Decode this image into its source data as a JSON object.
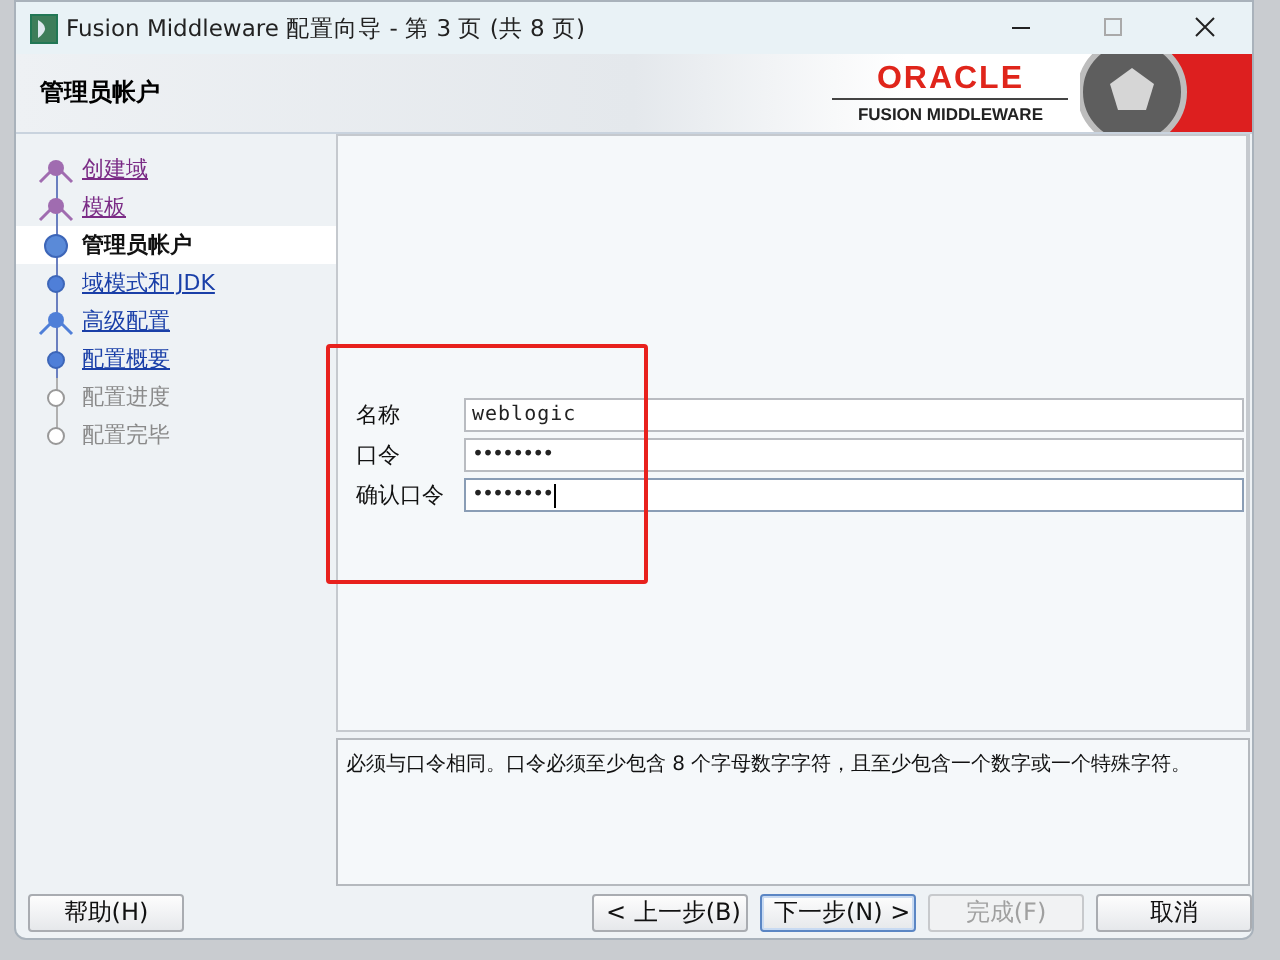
{
  "window": {
    "title": "Fusion Middleware 配置向导 - 第 3 页 (共 8 页)"
  },
  "header": {
    "title": "管理员帐户",
    "logo_title": "ORACLE",
    "logo_subtitle": "FUSION MIDDLEWARE"
  },
  "steps": [
    {
      "label": "创建域",
      "kind": "branch",
      "visited": true,
      "disabled": false,
      "selected": false
    },
    {
      "label": "模板",
      "kind": "branch",
      "visited": true,
      "disabled": false,
      "selected": false
    },
    {
      "label": "管理员帐户",
      "kind": "dot",
      "visited": false,
      "disabled": false,
      "selected": true
    },
    {
      "label": "域模式和 JDK",
      "kind": "dot",
      "visited": false,
      "disabled": false,
      "selected": false
    },
    {
      "label": "高级配置",
      "kind": "branch",
      "visited": false,
      "disabled": false,
      "selected": false
    },
    {
      "label": "配置概要",
      "kind": "dot",
      "visited": false,
      "disabled": false,
      "selected": false
    },
    {
      "label": "配置进度",
      "kind": "dot",
      "visited": false,
      "disabled": true,
      "selected": false
    },
    {
      "label": "配置完毕",
      "kind": "dot",
      "visited": false,
      "disabled": true,
      "selected": false
    }
  ],
  "fields": [
    {
      "label": "名称",
      "value": "weblogic",
      "kind": "text",
      "focused": false
    },
    {
      "label": "口令",
      "value": "••••••••",
      "kind": "password",
      "focused": false
    },
    {
      "label": "确认口令",
      "value": "••••••••",
      "kind": "password",
      "focused": true
    }
  ],
  "message": "必须与口令相同。口令必须至少包含 8 个字母数字字符，且至少包含一个数字或一个特殊字符。",
  "buttons": [
    {
      "label": "帮助(H)",
      "disabled": false,
      "default": false
    },
    {
      "label": "< 上一步(B)",
      "disabled": false,
      "default": false
    },
    {
      "label": "下一步(N) >",
      "disabled": false,
      "default": true
    },
    {
      "label": "完成(F)",
      "disabled": true,
      "default": false
    },
    {
      "label": "取消",
      "disabled": false,
      "default": false
    }
  ]
}
